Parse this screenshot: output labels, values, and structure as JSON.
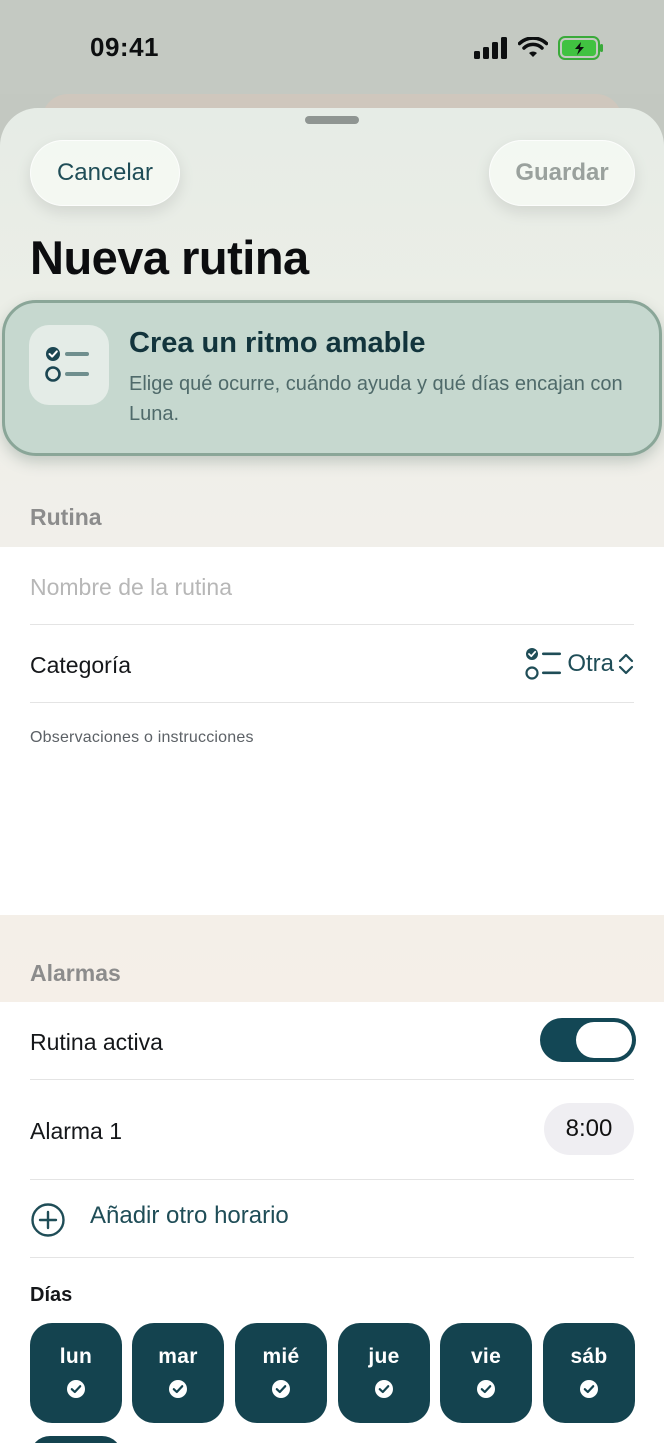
{
  "status_bar": {
    "time": "09:41"
  },
  "header": {
    "cancel_label": "Cancelar",
    "save_label": "Guardar",
    "title": "Nueva rutina"
  },
  "hero": {
    "icon": "checklist-icon",
    "title": "Crea un ritmo amable",
    "subtitle": "Elige qué ocurre, cuándo ayuda y qué días encajan con Luna."
  },
  "routine_section": {
    "label": "Rutina",
    "name_placeholder": "Nombre de la rutina",
    "category_label": "Categoría",
    "category_value": "Otra",
    "notes_placeholder": "Observaciones o instrucciones"
  },
  "alarms_section": {
    "label": "Alarmas",
    "active_label": "Rutina activa",
    "active_on": true,
    "alarm_label": "Alarma 1",
    "alarm_time": "8:00",
    "add_label": "Añadir otro horario"
  },
  "days": {
    "label": "Días",
    "items": [
      {
        "label": "lun",
        "selected": true
      },
      {
        "label": "mar",
        "selected": true
      },
      {
        "label": "mié",
        "selected": true
      },
      {
        "label": "jue",
        "selected": true
      },
      {
        "label": "vie",
        "selected": true
      },
      {
        "label": "sáb",
        "selected": true
      }
    ]
  },
  "colors": {
    "accent": "#14434f",
    "hero_bg": "#c6d8cf",
    "link": "#1f4d57"
  }
}
